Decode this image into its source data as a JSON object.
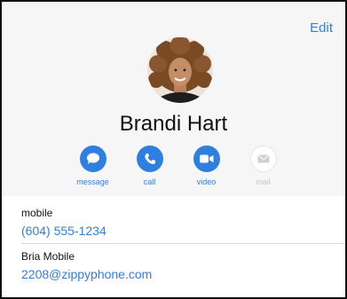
{
  "header": {
    "edit_label": "Edit"
  },
  "contact": {
    "name": "Brandi Hart"
  },
  "actions": [
    {
      "label": "message",
      "icon": "message-icon",
      "enabled": true
    },
    {
      "label": "call",
      "icon": "phone-icon",
      "enabled": true
    },
    {
      "label": "video",
      "icon": "video-icon",
      "enabled": true
    },
    {
      "label": "mail",
      "icon": "mail-icon",
      "enabled": false
    }
  ],
  "fields": [
    {
      "label": "mobile",
      "value": "(604) 555-1234"
    },
    {
      "label": "Bria Mobile",
      "value": "2208@zippyphone.com"
    }
  ],
  "colors": {
    "accent": "#2f7fe0",
    "header_bg": "#f6f6f7",
    "disabled": "#c6c6c6"
  }
}
